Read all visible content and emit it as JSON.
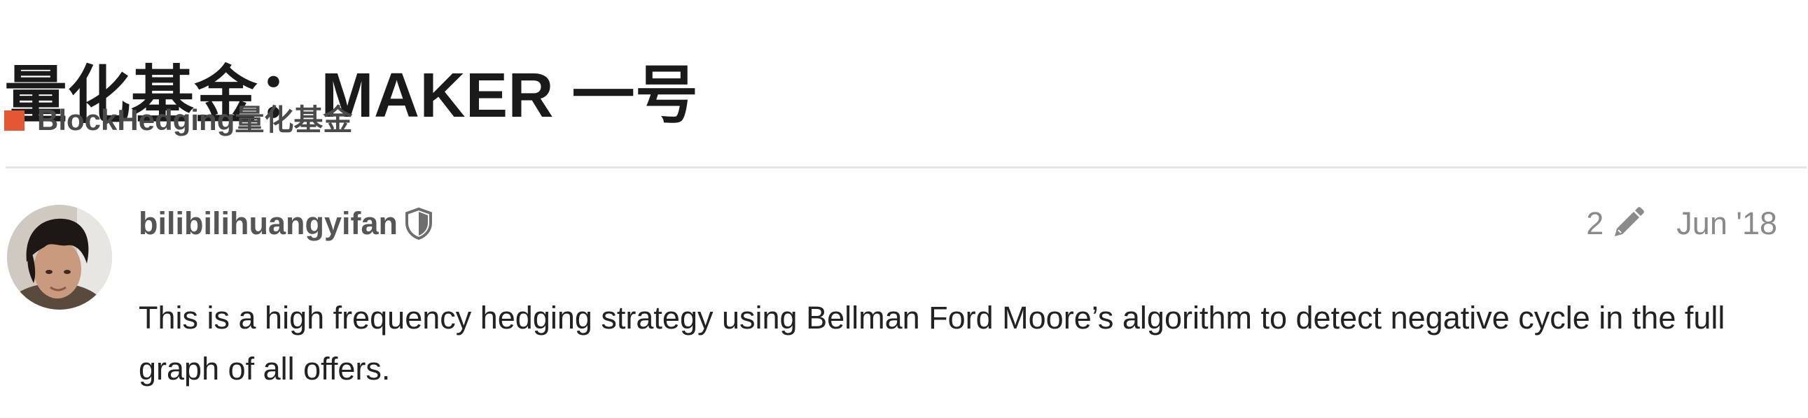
{
  "topic": {
    "title": "量化基金：MAKER 一号",
    "category": {
      "name": "BlockHedging量化基金",
      "color": "#e45735"
    }
  },
  "post": {
    "author": {
      "username": "bilibilihuangyifan",
      "badge_icon": "shield-icon",
      "avatar_icon": "user-avatar"
    },
    "edit_count": "2",
    "edit_icon": "pencil-icon",
    "date": "Jun '18",
    "body": "This is a high frequency hedging strategy using Bellman Ford Moore’s algorithm to detect negative cycle in the full graph of all offers."
  }
}
